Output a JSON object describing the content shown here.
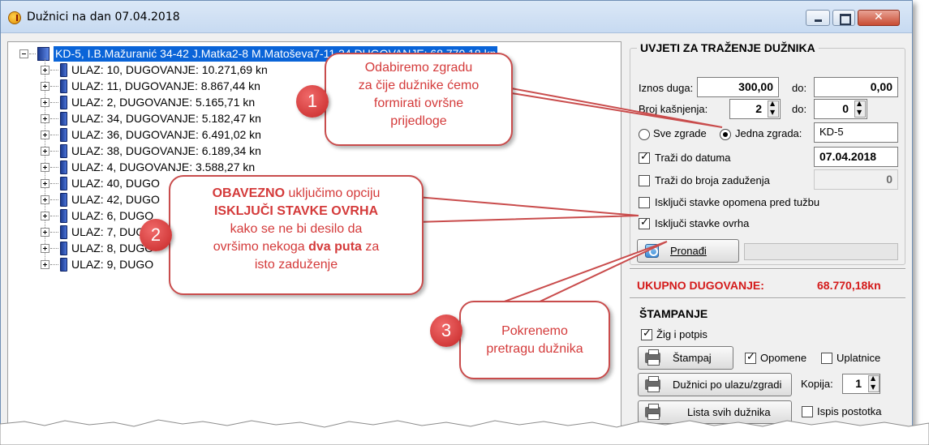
{
  "window": {
    "title": "Dužnici na dan 07.04.2018",
    "icon": "app-coin-icon"
  },
  "tree": {
    "root": "KD-5,  I.B.Mažuranić 34-42 J.Matka2-8 M.Matoševa7-11,34   DUGOVANJE: 68.770,18 kn",
    "nodes": [
      "ULAZ: 10,   DUGOVANJE: 10.271,69 kn",
      "ULAZ: 11,   DUGOVANJE: 8.867,44 kn",
      "ULAZ: 2,   DUGOVANJE: 5.165,71 kn",
      "ULAZ: 34,   DUGOVANJE: 5.182,47 kn",
      "ULAZ: 36,   DUGOVANJE: 6.491,02 kn",
      "ULAZ: 38,   DUGOVANJE: 6.189,34 kn",
      "ULAZ: 4,   DUGOVANJE: 3.588,27 kn",
      "ULAZ: 40,   DUGO",
      "ULAZ: 42,   DUGO",
      "ULAZ: 6,   DUGO",
      "ULAZ: 7,   DUGO",
      "ULAZ: 8,   DUGO",
      "ULAZ: 9,   DUGO"
    ]
  },
  "criteria": {
    "title": "UVJETI ZA TRAŽENJE DUŽNIKA",
    "iznos_label": "Iznos duga:",
    "iznos_from": "300,00",
    "do_label": "do:",
    "iznos_to": "0,00",
    "kasnjenja_label": "Broj kašnjenja:",
    "kasnjenja_from": "2",
    "kasnjenja_to": "0",
    "sve_zgrade": "Sve zgrade",
    "jedna_zgrada": "Jedna zgrada:",
    "zgrada_value": "KD-5",
    "trazi_datum": "Traži do datuma",
    "datum_value": "07.04.2018",
    "trazi_broj": "Traži do broja zaduženja",
    "broj_value": "0",
    "iskljuci_opomena": "Isključi stavke opomena pred tužbu",
    "iskljuci_ovrha": "Isključi stavke ovrha",
    "pronadi": "Pronađi"
  },
  "total": {
    "label": "UKUPNO DUGOVANJE:",
    "value": "68.770,18kn"
  },
  "printing": {
    "title": "ŠTAMPANJE",
    "zig": "Žig i potpis",
    "stampaj": "Štampaj",
    "opomene": "Opomene",
    "uplatnice": "Uplatnice",
    "duznici_ulaz": "Dužnici po ulazu/zgradi",
    "kopija_label": "Kopija:",
    "kopija_value": "1",
    "lista": "Lista svih dužnika",
    "ispis": "Ispis postotka"
  },
  "callouts": {
    "c1_num": "1",
    "c1_l1": "Odabiremo zgradu",
    "c1_l2": "za čije dužnike ćemo",
    "c1_l3": "formirati ovršne",
    "c1_l4": "prijedloge",
    "c2_num": "2",
    "c2_strong1": "OBAVEZNO",
    "c2_t1": " uključimo opciju",
    "c2_strong2": "ISKLJUČI STAVKE OVRHA",
    "c2_t2": "kako se ne bi desilo da",
    "c2_t3": "ovršimo nekoga ",
    "c2_strong3": "dva puta",
    "c2_t4": " za",
    "c2_t5": "isto zaduženje",
    "c3_num": "3",
    "c3_l1": "Pokrenemo",
    "c3_l2": "pretragu dužnika"
  },
  "colors": {
    "selection": "#0a64d8",
    "accent_red": "#d41a1a",
    "callout_border": "#c94c4c"
  }
}
